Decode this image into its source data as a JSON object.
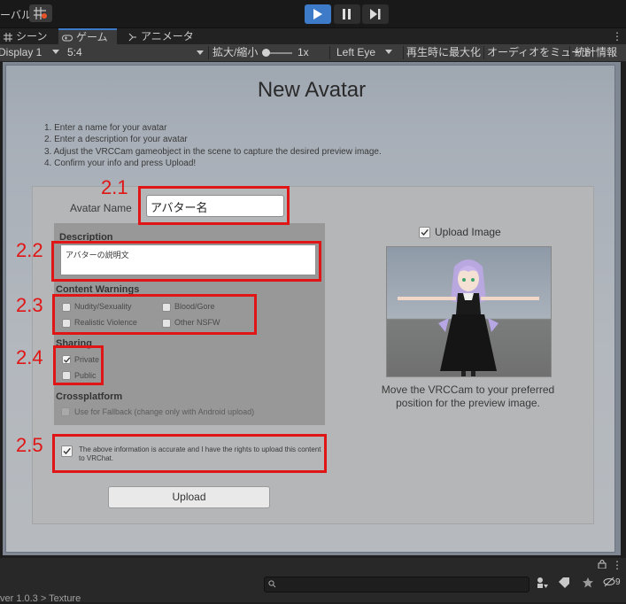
{
  "toolbar": {
    "left_label": "ーバル",
    "colors": {
      "play_active": "#3d7ac8"
    }
  },
  "tabs": [
    {
      "label": "シーン",
      "icon": "hash-icon"
    },
    {
      "label": "ゲーム",
      "icon": "gamepad-icon",
      "active": true
    },
    {
      "label": "アニメーター",
      "icon": "animator-icon"
    }
  ],
  "gamebar": {
    "display": "Display 1",
    "aspect": "5:4",
    "scale_label": "拡大/縮小",
    "scale_value": "1x",
    "eye": "Left Eye",
    "maximize": "再生時に最大化",
    "mute": "オーディオをミュート",
    "stats": "統計情報"
  },
  "panel": {
    "title": "New Avatar",
    "instructions": [
      "1. Enter a name for your avatar",
      "2. Enter a description for your avatar",
      "3. Adjust the VRCCam gameobject in the scene to capture the desired preview image.",
      "4. Confirm your info and press Upload!"
    ],
    "avatar_name_label": "Avatar Name",
    "avatar_name_value": "アバター名",
    "description_label": "Description",
    "description_value": "アバターの説明文",
    "content_warnings_label": "Content Warnings",
    "warnings": {
      "nudity": "Nudity/Sexuality",
      "blood": "Blood/Gore",
      "violence": "Realistic Violence",
      "nsfw": "Other NSFW"
    },
    "sharing_label": "Sharing",
    "sharing": {
      "private": "Private",
      "public": "Public",
      "selected": "Private"
    },
    "crossplatform_label": "Crossplatform",
    "fallback_label": "Use for Fallback (change only with Android upload)",
    "confirm_text": "The above information is accurate and I have the rights to upload this content to VRChat.",
    "upload_button": "Upload",
    "upload_image_label": "Upload Image",
    "preview_caption": "Move the VRCCam to your preferred position for the preview image."
  },
  "annotations": {
    "a21": "2.1",
    "a22": "2.2",
    "a23": "2.3",
    "a24": "2.4",
    "a25": "2.5",
    "color": "#e01616"
  },
  "bottom": {
    "breadcrumb": "ver 1.0.3 > Texture",
    "hidden_count": "9"
  }
}
